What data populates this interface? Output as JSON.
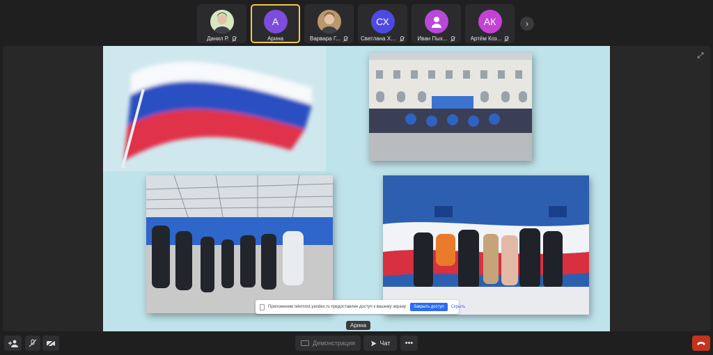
{
  "participants": [
    {
      "name": "Данил Р.",
      "initials": "",
      "avatar_type": "photo",
      "color": "#d7e7c0",
      "active": false
    },
    {
      "name": "Арина",
      "initials": "А",
      "avatar_type": "initials",
      "color": "#7c4ddc",
      "active": true
    },
    {
      "name": "Варвара Г...",
      "initials": "",
      "avatar_type": "photo",
      "color": "#b9986e",
      "active": false
    },
    {
      "name": "Светлана Хи...",
      "initials": "СХ",
      "avatar_type": "initials",
      "color": "#4d4ae3",
      "active": false
    },
    {
      "name": "Иван Пых...",
      "initials": "",
      "avatar_type": "person-icon",
      "color": "#b748d8",
      "active": false
    },
    {
      "name": "Артём Коз...",
      "initials": "АК",
      "avatar_type": "initials",
      "color": "#c441d4",
      "active": false
    }
  ],
  "speaker_label": "Арина",
  "banner": {
    "text": "Приложению telemost.yandex.ru предоставлен доступ к вашему экрану.",
    "stop_label": "Закрыть доступ",
    "hide_label": "Скрыть"
  },
  "controls": {
    "demo_label": "Демонстрация",
    "chat_label": "Чат",
    "more_label": "•••"
  },
  "colors": {
    "accent": "#f2c94c",
    "end_call": "#c3341f",
    "banner_button": "#2a6cf0"
  }
}
